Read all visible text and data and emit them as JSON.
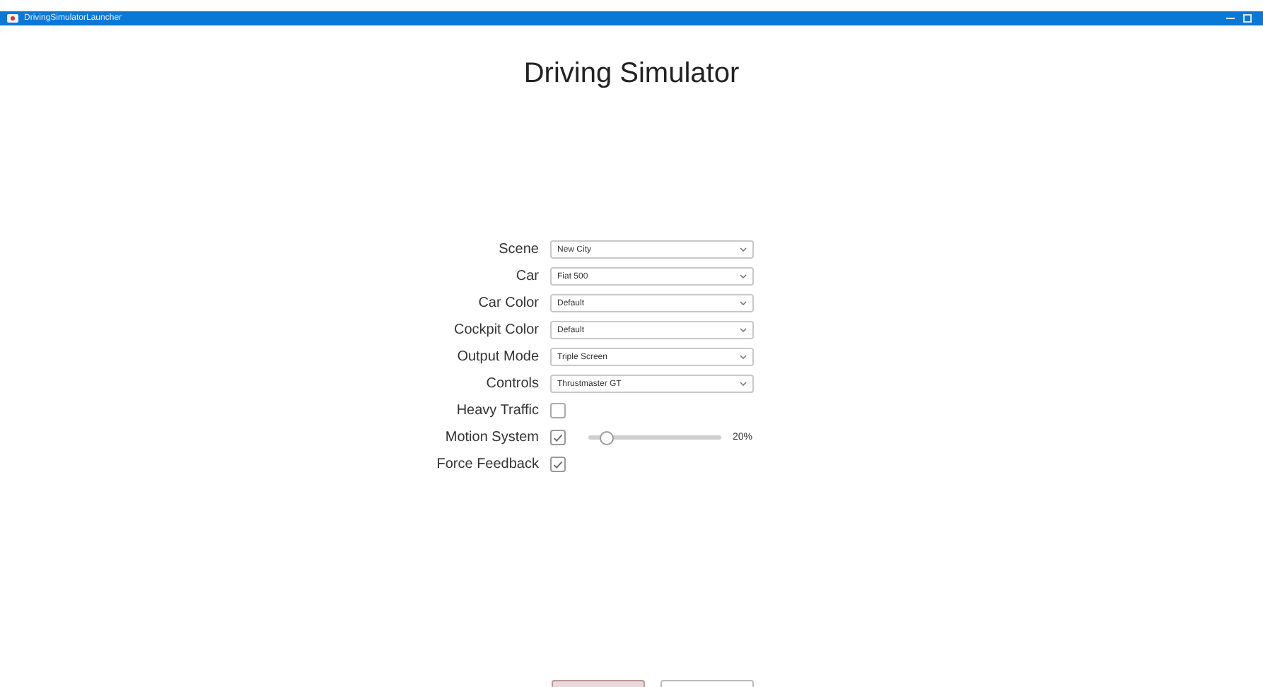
{
  "window": {
    "title": "DrivingSimulatorLauncher"
  },
  "heading": "Driving Simulator",
  "fields": [
    {
      "kind": "dropdown",
      "label": "Scene",
      "value": "New City"
    },
    {
      "kind": "dropdown",
      "label": "Car",
      "value": "Fiat 500"
    },
    {
      "kind": "dropdown",
      "label": "Car Color",
      "value": "Default"
    },
    {
      "kind": "dropdown",
      "label": "Cockpit Color",
      "value": "Default"
    },
    {
      "kind": "dropdown",
      "label": "Output Mode",
      "value": "Triple Screen"
    },
    {
      "kind": "dropdown",
      "label": "Controls",
      "value": "Thrustmaster GT"
    },
    {
      "kind": "checkbox",
      "label": "Heavy Traffic",
      "checked": false
    },
    {
      "kind": "checkbox-slider",
      "label": "Motion System",
      "checked": true,
      "level": 0.1,
      "reading": "20%"
    },
    {
      "kind": "checkbox",
      "label": "Force Feedback",
      "checked": true
    }
  ],
  "buttons": [
    {
      "selected": true
    },
    {
      "selected": false
    }
  ]
}
